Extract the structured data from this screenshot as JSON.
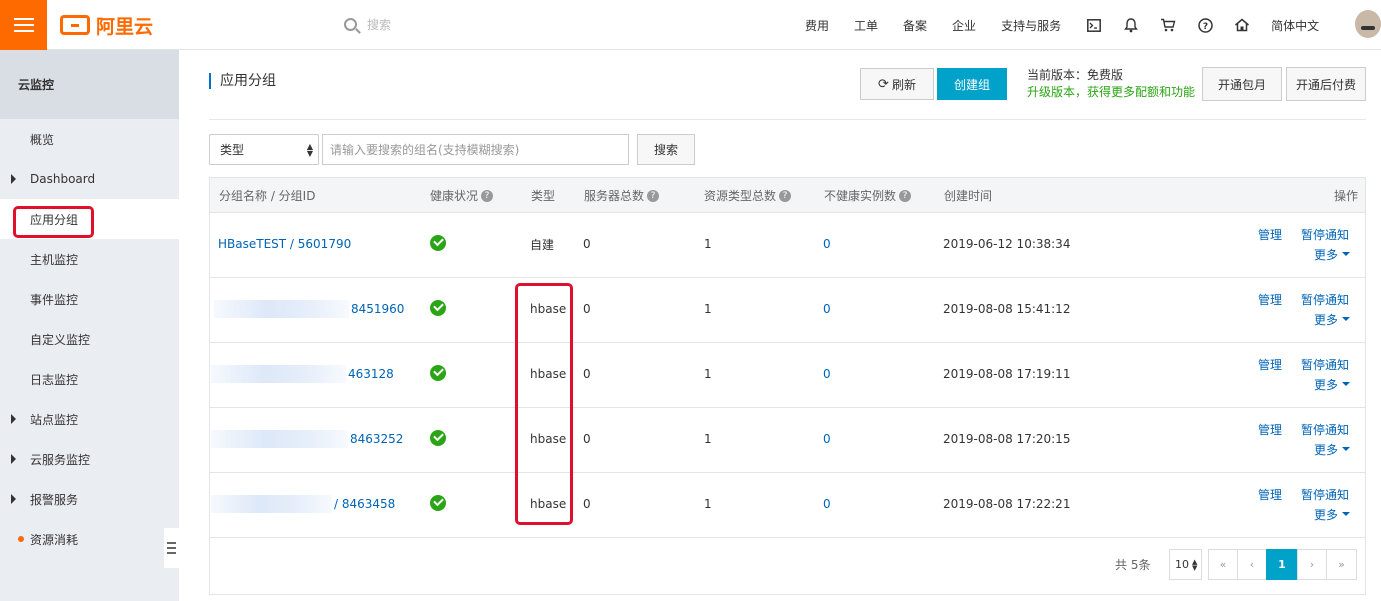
{
  "topbar": {
    "brand": "阿里云",
    "search_placeholder": "搜索",
    "nav": [
      "费用",
      "工单",
      "备案",
      "企业",
      "支持与服务"
    ],
    "icons": [
      "terminal-icon",
      "bell-icon",
      "cart-icon",
      "help-icon",
      "home-icon"
    ],
    "language": "简体中文"
  },
  "sidebar": {
    "title": "云监控",
    "items": [
      {
        "label": "概览",
        "expandable": false
      },
      {
        "label": "Dashboard",
        "expandable": true
      },
      {
        "label": "应用分组",
        "expandable": false,
        "active": true
      },
      {
        "label": "主机监控",
        "expandable": false
      },
      {
        "label": "事件监控",
        "expandable": false
      },
      {
        "label": "自定义监控",
        "expandable": false
      },
      {
        "label": "日志监控",
        "expandable": false
      },
      {
        "label": "站点监控",
        "expandable": true
      },
      {
        "label": "云服务监控",
        "expandable": true
      },
      {
        "label": "报警服务",
        "expandable": true
      },
      {
        "label": "资源消耗",
        "expandable": false,
        "dot": true
      }
    ]
  },
  "header": {
    "title": "应用分组",
    "refresh_label": "刷新",
    "create_label": "创建组",
    "current_version": "当前版本：免费版",
    "upgrade_text": "升级版本，获得更多配额和功能",
    "monthly_label": "开通包月",
    "postpaid_label": "开通后付费"
  },
  "filter": {
    "type_select": "类型",
    "search_placeholder": "请输入要搜索的组名(支持模糊搜索)",
    "search_button": "搜索"
  },
  "table": {
    "columns": [
      "分组名称 / 分组ID",
      "健康状况",
      "类型",
      "服务器总数",
      "资源类型总数",
      "不健康实例数",
      "创建时间",
      "操作"
    ],
    "rows": [
      {
        "name": "HBaseTEST / 5601790",
        "type": "自建",
        "servers": "0",
        "resource_types": "1",
        "unhealthy": "0",
        "created": "2019-06-12 10:38:34"
      },
      {
        "name": "8451960",
        "type": "hbase",
        "servers": "0",
        "resource_types": "1",
        "unhealthy": "0",
        "created": "2019-08-08 15:41:12"
      },
      {
        "name": "463128",
        "type": "hbase",
        "servers": "0",
        "resource_types": "1",
        "unhealthy": "0",
        "created": "2019-08-08 17:19:11"
      },
      {
        "name": "8463252",
        "type": "hbase",
        "servers": "0",
        "resource_types": "1",
        "unhealthy": "0",
        "created": "2019-08-08 17:20:15"
      },
      {
        "name": "/ 8463458",
        "type": "hbase",
        "servers": "0",
        "resource_types": "1",
        "unhealthy": "0",
        "created": "2019-08-08 17:22:21"
      }
    ],
    "actions": {
      "manage": "管理",
      "pause": "暂停通知",
      "more": "更多"
    }
  },
  "pagination": {
    "total": "共 5条",
    "page_size": "10",
    "first": "«",
    "prev": "‹",
    "current": "1",
    "next": "›",
    "last": "»"
  },
  "colors": {
    "accent": "#ff6a00",
    "primary": "#00a2ca",
    "link": "#0064b6",
    "success": "#2aa515",
    "highlight": "#e0102b"
  }
}
